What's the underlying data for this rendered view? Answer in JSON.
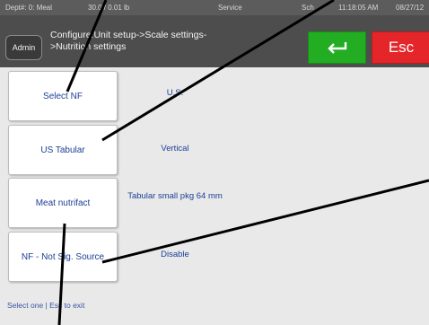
{
  "status_bar": {
    "dept": "Dept#: 0: Meal",
    "weight": "30.0 / 0.01 lb",
    "mode": "Service",
    "extra": "Sch",
    "time": "11:18:05 AM",
    "date": "08/27/12"
  },
  "header": {
    "admin": "Admin",
    "breadcrumb_line1": "Configure:Unit setup->Scale settings-",
    "breadcrumb_line2": ">Nutrition settings",
    "esc": "Esc",
    "enter_icon": "enter-arrow"
  },
  "options": [
    {
      "label": "Select NF",
      "value": "U.S."
    },
    {
      "label": "US Tabular",
      "value": "Vertical"
    },
    {
      "label": "Meat nutrifact",
      "value": "Tabular small pkg 64 mm"
    },
    {
      "label": "NF - Not Sig. Source",
      "value": "Disable"
    }
  ],
  "footer": {
    "hint": "Select one | Esc to exit"
  },
  "colors": {
    "enter": "#22ad22",
    "esc": "#e4262b",
    "text_blue": "#1c3f95"
  }
}
